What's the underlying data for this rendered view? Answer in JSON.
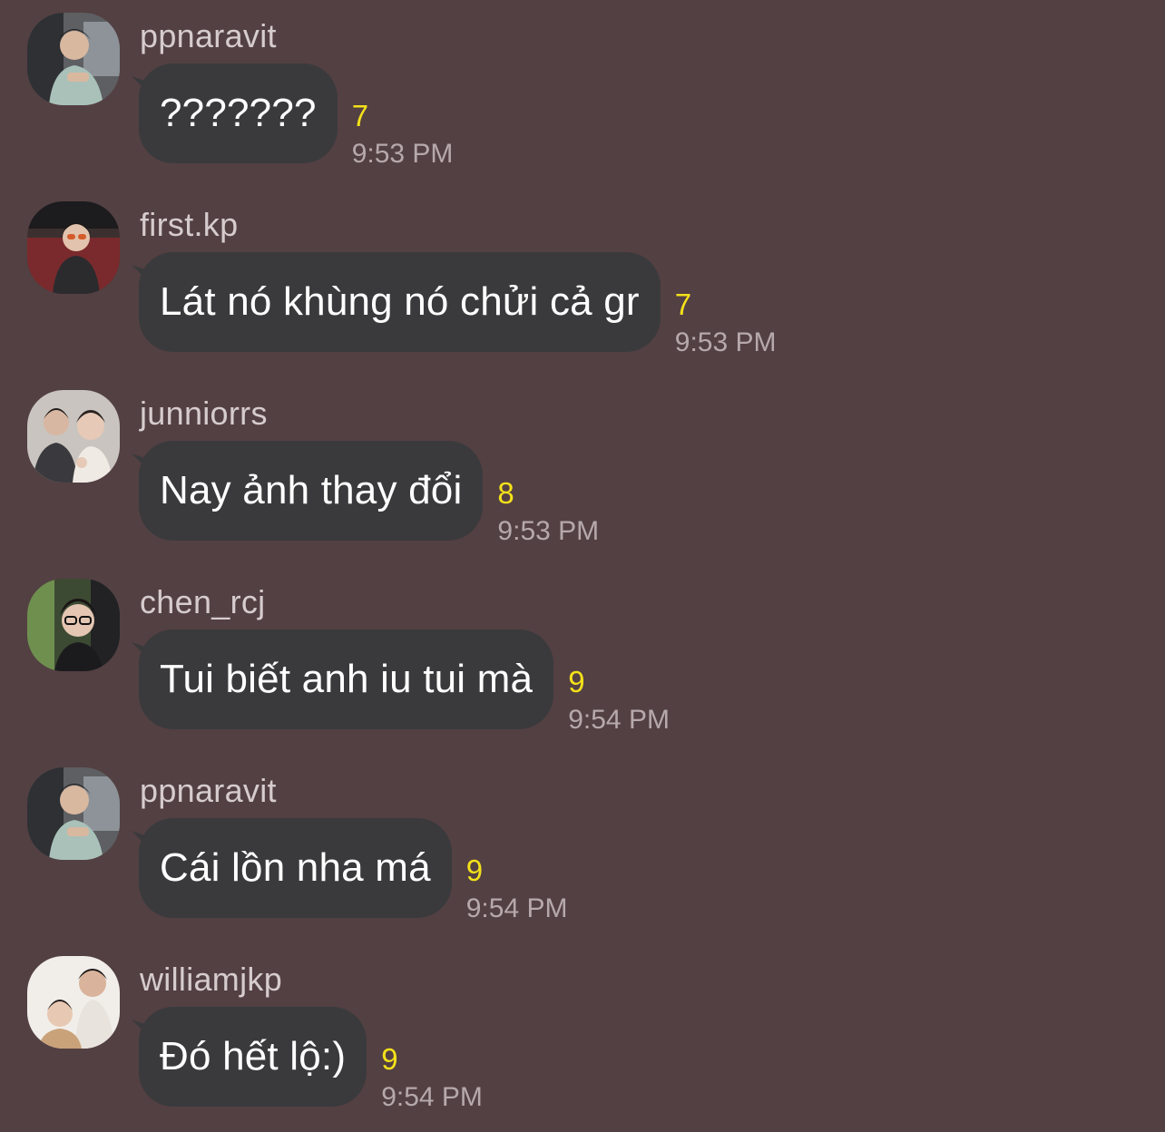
{
  "messages": [
    {
      "sender": "ppnaravit",
      "text": "???????",
      "read_count": "7",
      "time": "9:53 PM",
      "avatar": "avatar-icon"
    },
    {
      "sender": "first.kp",
      "text": "Lát nó khùng nó chửi cả gr",
      "read_count": "7",
      "time": "9:53 PM",
      "avatar": "avatar-icon"
    },
    {
      "sender": "junniorrs",
      "text": "Nay ảnh thay đổi",
      "read_count": "8",
      "time": "9:53 PM",
      "avatar": "avatar-icon"
    },
    {
      "sender": "chen_rcj",
      "text": "Tui biết anh iu tui mà",
      "read_count": "9",
      "time": "9:54 PM",
      "avatar": "avatar-icon"
    },
    {
      "sender": "ppnaravit",
      "text": "Cái lồn nha má",
      "read_count": "9",
      "time": "9:54 PM",
      "avatar": "avatar-icon"
    },
    {
      "sender": "williamjkp",
      "text": "Đó hết lộ:)",
      "read_count": "9",
      "time": "9:54 PM",
      "avatar": "avatar-icon"
    }
  ],
  "colors": {
    "background": "#534043",
    "bubble": "#3a3a3c",
    "read_count": "#f3e11a",
    "time": "#b6a9ab",
    "sender": "#d6cccd"
  }
}
